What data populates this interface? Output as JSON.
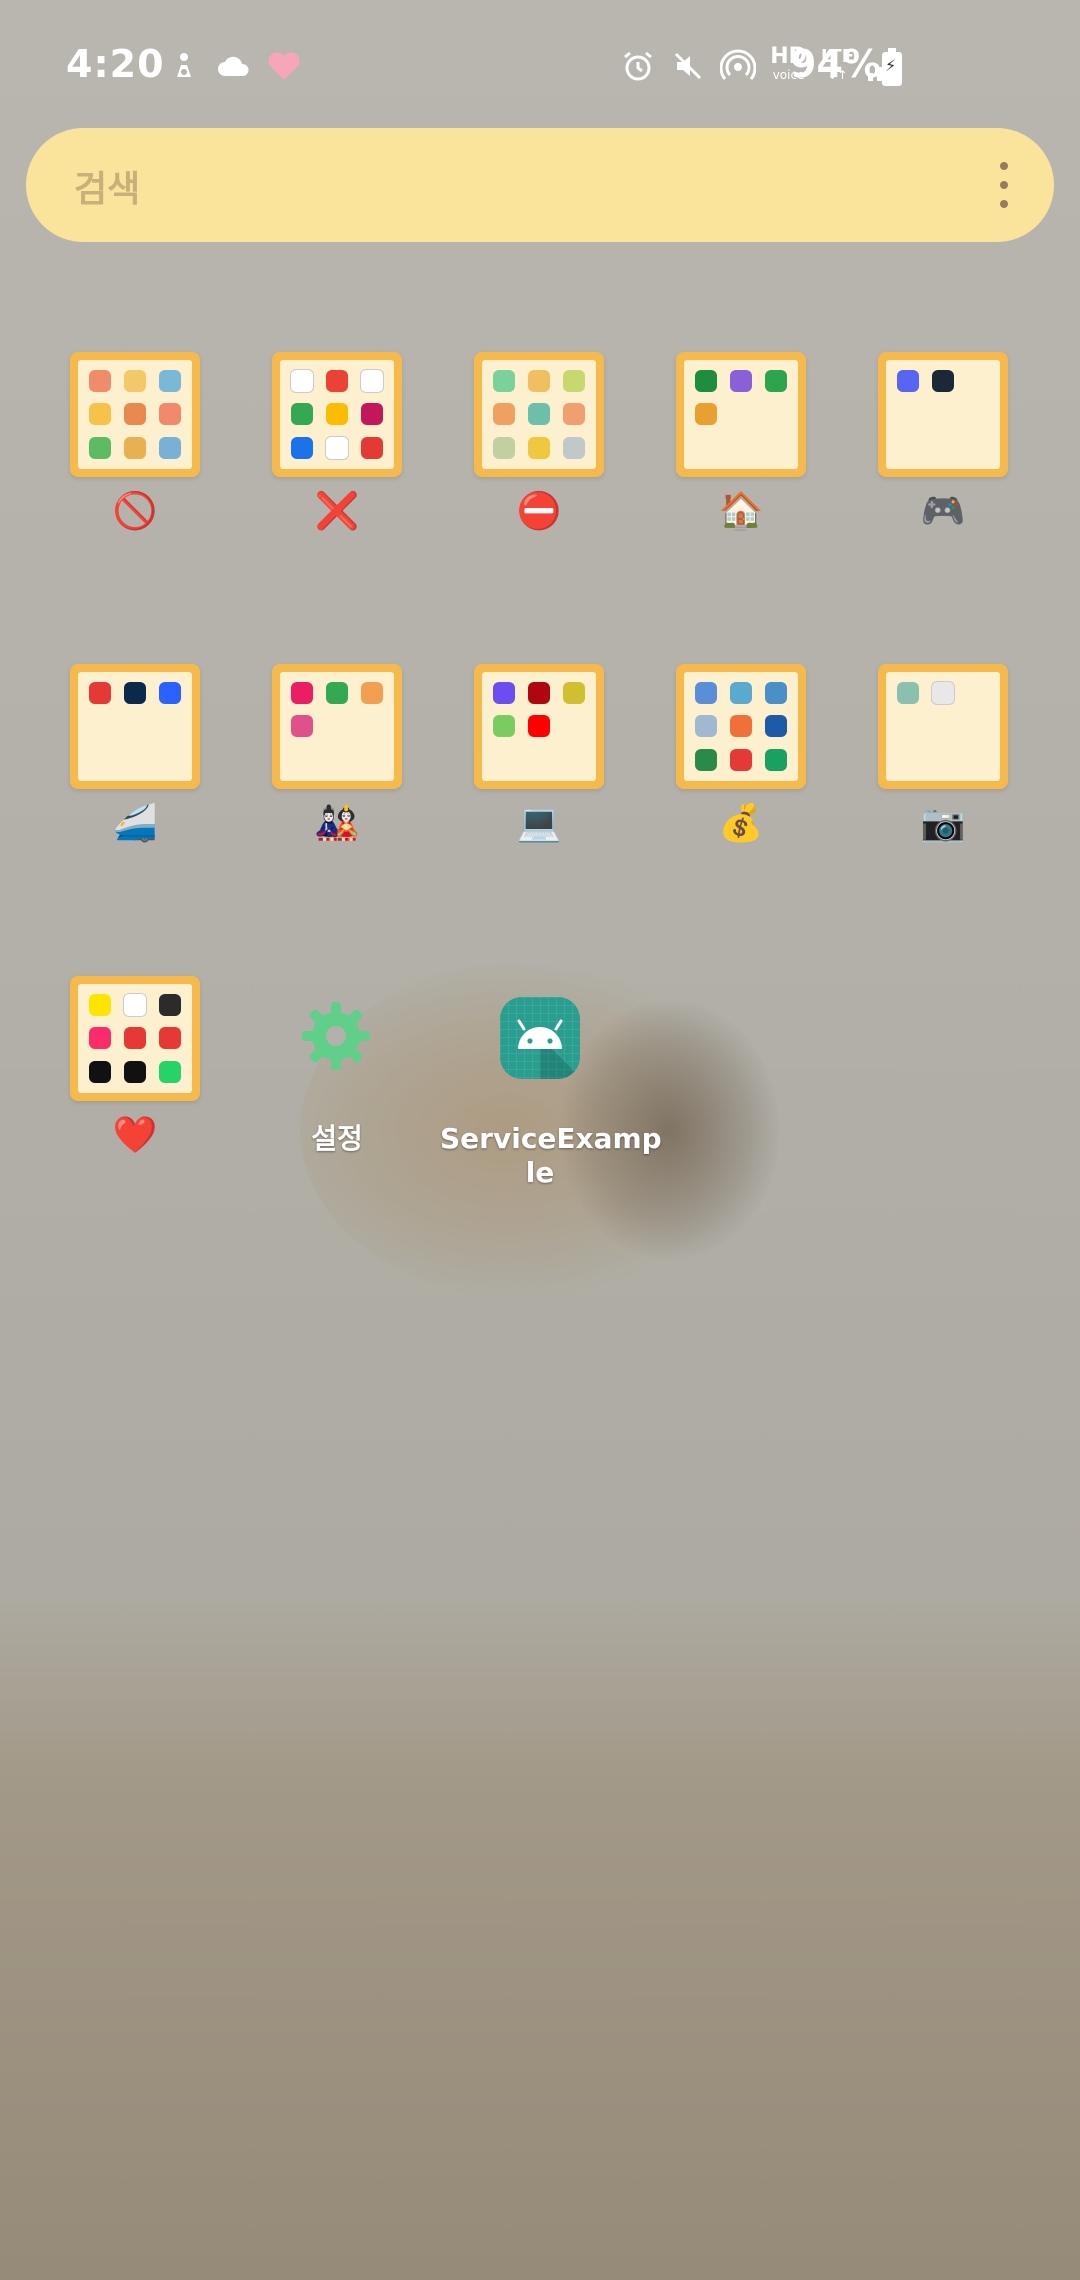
{
  "status_bar": {
    "time": "4:20",
    "battery": "94%",
    "left_icons": [
      "person-icon",
      "cloud-icon",
      "heart-icon"
    ],
    "right_icons": [
      "alarm-icon",
      "mute-icon",
      "hotspot-icon",
      "hd-voice-icon",
      "lte-icon",
      "signal-icon",
      "battery-charging-icon"
    ],
    "hd_label": "HD",
    "voice_label": "voice",
    "lte_label": "LTE"
  },
  "search": {
    "placeholder": "검색"
  },
  "folders": [
    {
      "label": "🚫",
      "icon_colors": [
        "#f08c6a",
        "#f2c86a",
        "#7ab9d6",
        "#f6c24a",
        "#e88a50",
        "#f08a6a",
        "#5dbb63",
        "#e8b050",
        "#78b0d6"
      ]
    },
    {
      "label": "❌",
      "icon_colors": [
        "#ffffff",
        "#ea4335",
        "#ffffff",
        "#34a853",
        "#fbbc04",
        "#c2185b",
        "#1a73e8",
        "#ffffff",
        "#e53935"
      ]
    },
    {
      "label": "⛔",
      "icon_colors": [
        "#7ad19a",
        "#f0c060",
        "#c8d870",
        "#f0a060",
        "#6cbfa8",
        "#f0a070",
        "#c0d0a0",
        "#f0c840",
        "#c0c8c8"
      ]
    },
    {
      "label": "🏠",
      "icon_colors": [
        "#1e8e3e",
        "#8b5fd8",
        "#2da44e",
        "#e8a030"
      ]
    },
    {
      "label": "🎮",
      "icon_colors": [
        "#5865f2",
        "#1b2838"
      ]
    },
    {
      "label": "🚄",
      "icon_colors": [
        "#e53935",
        "#0b2a4a",
        "#2962ff"
      ]
    },
    {
      "label": "🎎",
      "icon_colors": [
        "#e91e63",
        "#34a853",
        "#f0a050",
        "#e0508a"
      ]
    },
    {
      "label": "💻",
      "icon_colors": [
        "#6d4cf0",
        "#b00610",
        "#d0c030",
        "#7acc60",
        "#ff0000"
      ]
    },
    {
      "label": "💰",
      "icon_colors": [
        "#5a8fd8",
        "#5aaad0",
        "#4a90c8",
        "#a0b8d0",
        "#f0703a",
        "#1e5aa8",
        "#2a8a4a",
        "#e53935",
        "#1aa060"
      ]
    },
    {
      "label": "📷",
      "icon_colors": [
        "#8ac0b0",
        "#e8e8e8"
      ]
    },
    {
      "label": "❤️",
      "icon_colors": [
        "#fee500",
        "#ffffff",
        "#2b2b2b",
        "#fa2c6a",
        "#e53935",
        "#e53935",
        "#111111",
        "#111111",
        "#25d366"
      ]
    }
  ],
  "apps": [
    {
      "label": "설정",
      "icon": "gear-icon"
    },
    {
      "label_line1": "ServiceExamp",
      "label_line2": "le",
      "icon": "android-icon"
    }
  ],
  "colors": {
    "folder_border": "#f6b94c",
    "folder_fill": "#fdf0cf",
    "search_bg": "#fae39b",
    "settings_green": "#5fcf8a",
    "android_teal": "#2a9d8f"
  }
}
